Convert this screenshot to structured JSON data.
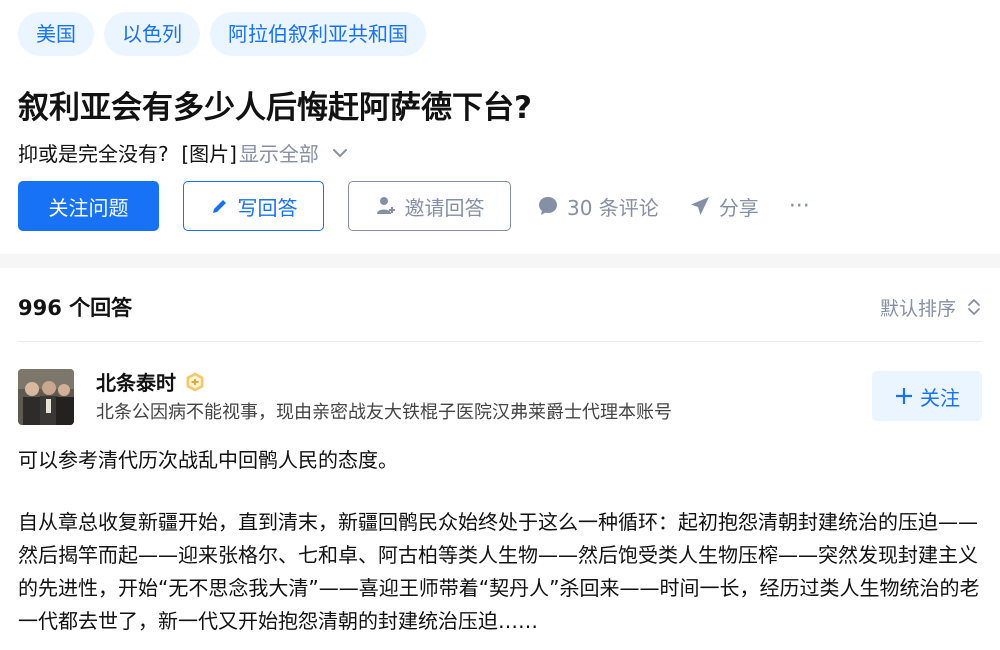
{
  "tags": [
    "美国",
    "以色列",
    "阿拉伯叙利亚共和国"
  ],
  "question": {
    "title": "叙利亚会有多少人后悔赶阿萨德下台?",
    "detail": "抑或是完全没有?  [图片]",
    "show_all": "显示全部"
  },
  "actions": {
    "follow_question": "关注问题",
    "write_answer": "写回答",
    "invite_answer": "邀请回答",
    "comments": "30 条评论",
    "share": "分享",
    "more": "···"
  },
  "answers": {
    "count": "996 个回答",
    "sort": "默认排序"
  },
  "author": {
    "name": "北条泰时",
    "bio": "北条公因病不能视事，现由亲密战友大铁棍子医院汉弗莱爵士代理本账号",
    "follow": "关注"
  },
  "content": {
    "p1": "可以参考清代历次战乱中回鹘人民的态度。",
    "p2": "自从章总收复新疆开始，直到清末，新疆回鹘民众始终处于这么一种循环：起初抱怨清朝封建统治的压迫——然后揭竿而起——迎来张格尔、七和卓、阿古柏等类人生物——然后饱受类人生物压榨——突然发现封建主义的先进性，开始“无不思念我大清”——喜迎王师带着“契丹人”杀回来——时间一长，经历过类人生物统治的老一代都去世了，新一代又开始抱怨清朝的封建统治压迫……"
  },
  "colors": {
    "brand": "#1772f6",
    "tag_bg": "#ebf5ff",
    "muted": "#8590a6"
  },
  "icons": [
    "pencil-icon",
    "invite-user-icon",
    "comment-bubble-icon",
    "paper-plane-icon",
    "chevron-down-icon",
    "sort-updown-icon",
    "plus-icon",
    "badge-icon"
  ]
}
